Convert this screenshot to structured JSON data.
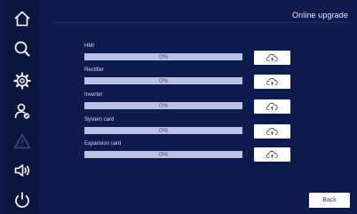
{
  "header": {
    "title": "Online upgrade"
  },
  "colors": {
    "background": "#0d1b4e",
    "sidebar": "#0a1640",
    "bar_track": "#b9c2e2",
    "icon": "#ffffff",
    "icon_disabled": "#3a4a78"
  },
  "sidebar": {
    "items": [
      {
        "icon": "home-icon",
        "enabled": true
      },
      {
        "icon": "search-icon",
        "enabled": true
      },
      {
        "icon": "settings-gear-icon",
        "enabled": true
      },
      {
        "icon": "user-check-icon",
        "enabled": true
      },
      {
        "icon": "warning-icon",
        "enabled": false
      },
      {
        "icon": "speaker-icon",
        "enabled": true
      },
      {
        "icon": "power-icon",
        "enabled": true
      }
    ]
  },
  "upgrade_items": [
    {
      "label": "HMI",
      "progress_text": "0%",
      "progress": 0,
      "upload_icon": "cloud-upload-icon"
    },
    {
      "label": "Rectifier",
      "progress_text": "0%",
      "progress": 0,
      "upload_icon": "cloud-upload-icon"
    },
    {
      "label": "Inverter",
      "progress_text": "0%",
      "progress": 0,
      "upload_icon": "cloud-upload-icon"
    },
    {
      "label": "System card",
      "progress_text": "0%",
      "progress": 0,
      "upload_icon": "cloud-upload-icon"
    },
    {
      "label": "Expansion card",
      "progress_text": "0%",
      "progress": 0,
      "upload_icon": "cloud-upload-icon"
    }
  ],
  "footer": {
    "back_label": "Back"
  }
}
